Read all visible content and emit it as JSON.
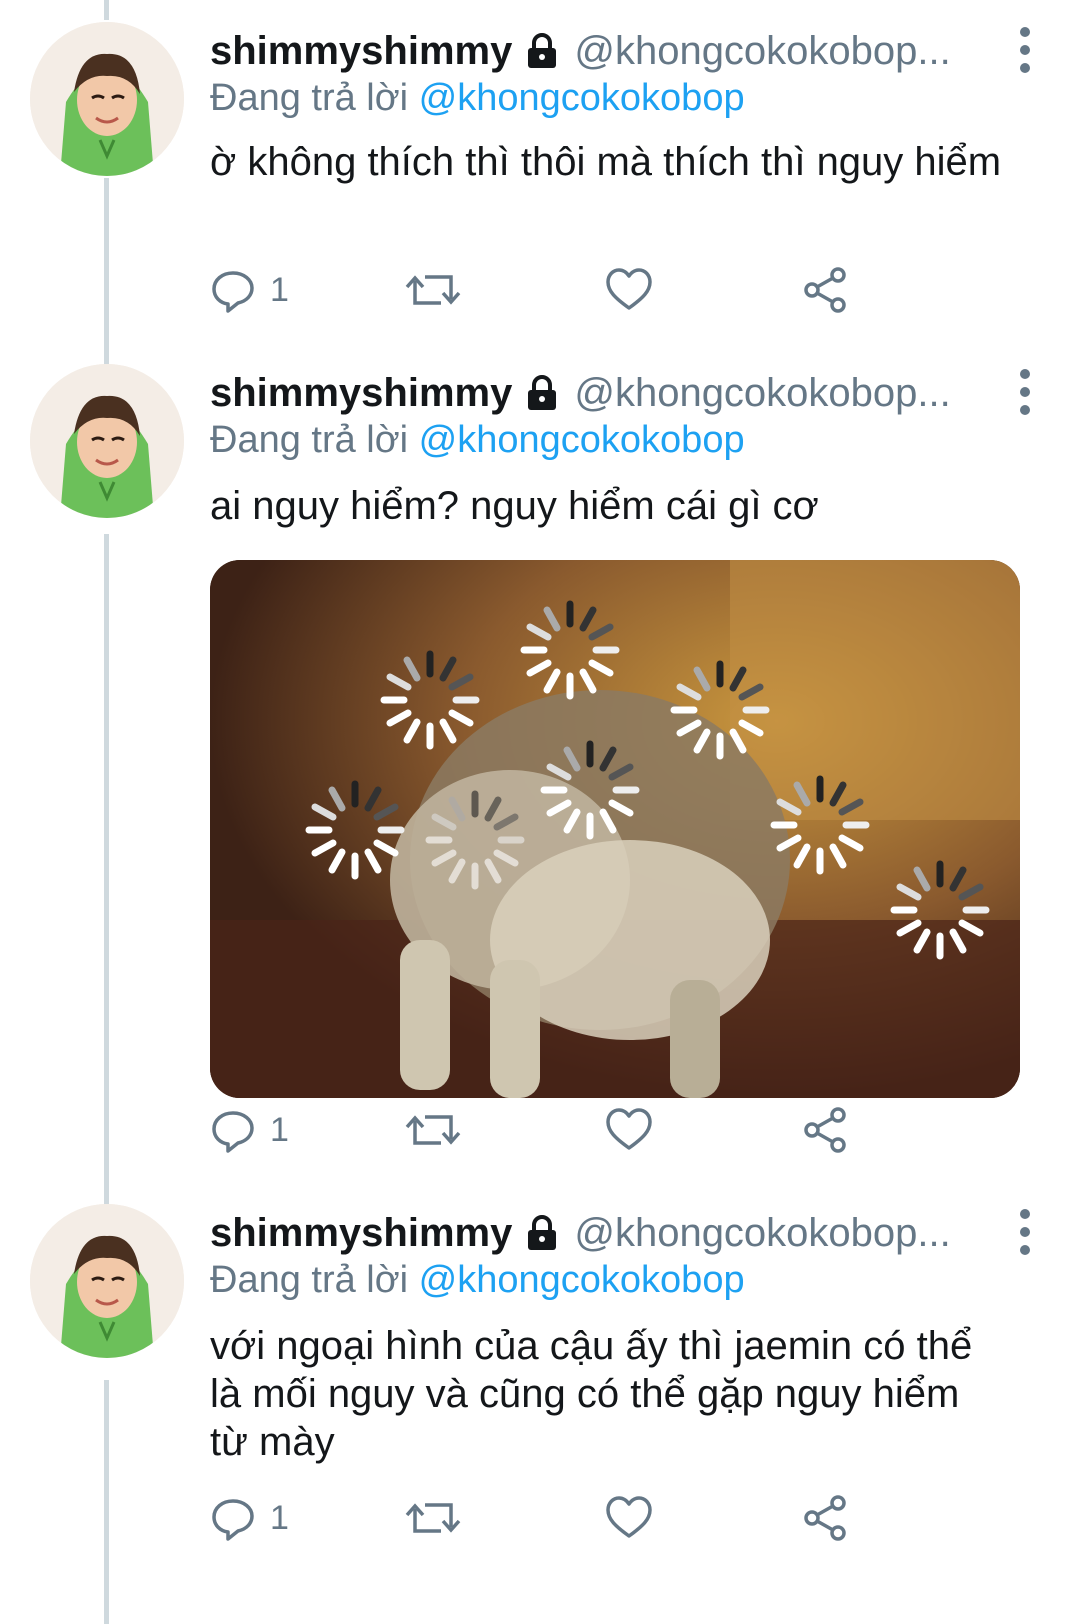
{
  "tweets": [
    {
      "name": "shimmyshimmy",
      "handle": "@khongcokokobop...",
      "replying_prefix": "Đang trả lời",
      "replying_to": "@khongcokokobop",
      "text": "ờ không thích thì thôi mà thích thì nguy hiểm",
      "reply_count": "1",
      "has_media": false
    },
    {
      "name": "shimmyshimmy",
      "handle": "@khongcokokobop...",
      "replying_prefix": "Đang trả lời",
      "replying_to": "@khongcokokobop",
      "text": "ai nguy hiểm? nguy hiểm cái gì cơ",
      "reply_count": "1",
      "has_media": true
    },
    {
      "name": "shimmyshimmy",
      "handle": "@khongcokokobop...",
      "replying_prefix": "Đang trả lời",
      "replying_to": "@khongcokokobop",
      "text": "với ngoại hình của cậu ấy thì jaemin có thể là mối nguy và cũng có thể gặp nguy hiểm từ mày",
      "reply_count": "1",
      "has_media": false
    }
  ],
  "colors": {
    "text": "#14171a",
    "secondary": "#657786",
    "link": "#1da1f2",
    "thread_line": "#cfd9de"
  },
  "icons": [
    "lock-icon",
    "more-vertical-icon",
    "reply-icon",
    "retweet-icon",
    "like-icon",
    "share-icon"
  ]
}
